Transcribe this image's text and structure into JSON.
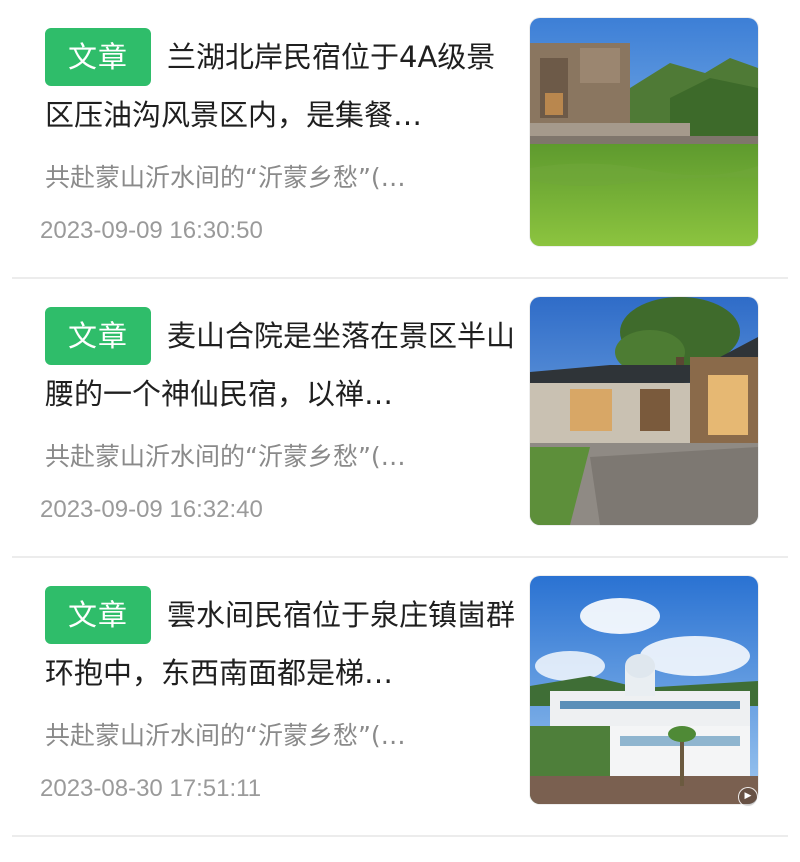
{
  "articles": [
    {
      "tag": "文章",
      "title": "兰湖北岸民宿位于4A级景区压油沟风景区内，是集餐…",
      "summary": "共赴蒙山沂水间的“沂蒙乡愁”(…",
      "time": "2023-09-09 16:30:50",
      "image_icon": "lake-village-photo"
    },
    {
      "tag": "文章",
      "title": "麦山合院是坐落在景区半山腰的一个神仙民宿，以禅…",
      "summary": "共赴蒙山沂水间的“沂蒙乡愁”(…",
      "time": "2023-09-09 16:32:40",
      "image_icon": "courtyard-house-photo"
    },
    {
      "tag": "文章",
      "title": "雲水间民宿位于泉庄镇崮群环抱中，东西南面都是梯…",
      "summary": "共赴蒙山沂水间的“沂蒙乡愁”(…",
      "time": "2023-08-30 17:51:11",
      "image_icon": "white-villa-photo"
    }
  ],
  "colors": {
    "tag_background": "#2fbd6a",
    "title_text": "#1f1f1f",
    "summary_text": "#8a8a8a",
    "time_text": "#9a9a9a"
  }
}
